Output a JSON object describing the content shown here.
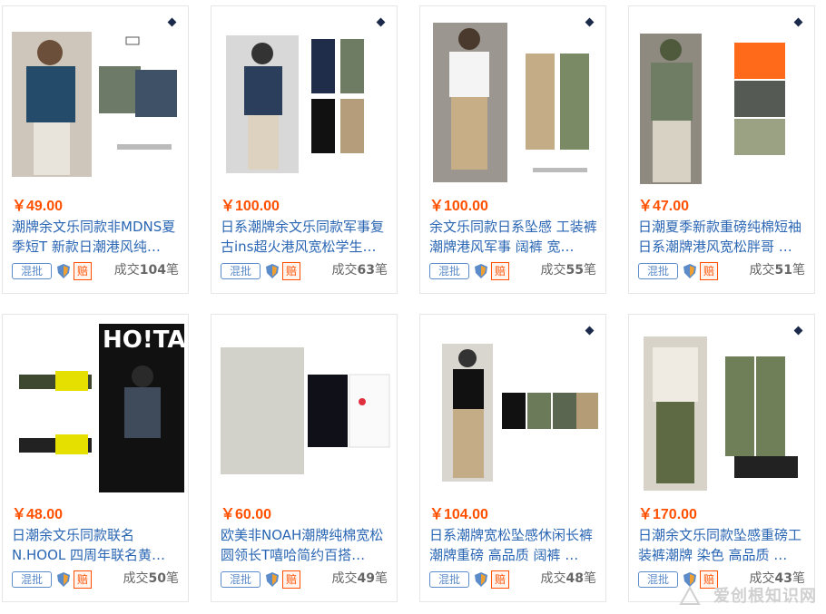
{
  "cards": [
    {
      "price": "￥49.00",
      "title": "潮牌余文乐同款非MDNS夏季短T 新款日潮港风纯…",
      "badge": "混批",
      "pei": "赔",
      "sold_prefix": "成交",
      "sold_num": "104",
      "sold_suffix": "笔"
    },
    {
      "price": "￥100.00",
      "title": "日系潮牌余文乐同款军事复古ins超火港风宽松学生…",
      "badge": "混批",
      "pei": "赔",
      "sold_prefix": "成交",
      "sold_num": "63",
      "sold_suffix": "笔"
    },
    {
      "price": "￥100.00",
      "title": "余文乐同款日系坠感 工装裤潮牌港风军事 阔裤 宽…",
      "badge": "混批",
      "pei": "赔",
      "sold_prefix": "成交",
      "sold_num": "55",
      "sold_suffix": "笔"
    },
    {
      "price": "￥47.00",
      "title": "日潮夏季新款重磅纯棉短袖日系潮牌港风宽松胖哥 …",
      "badge": "混批",
      "pei": "赔",
      "sold_prefix": "成交",
      "sold_num": "51",
      "sold_suffix": "笔"
    },
    {
      "price": "￥48.00",
      "title": "日潮余文乐同款联名N.HOOL 四周年联名黄…",
      "badge": "混批",
      "pei": "赔",
      "sold_prefix": "成交",
      "sold_num": "50",
      "sold_suffix": "笔"
    },
    {
      "price": "￥60.00",
      "title": "欧美非NOAH潮牌纯棉宽松圆领长T嘻哈简约百搭…",
      "badge": "混批",
      "pei": "赔",
      "sold_prefix": "成交",
      "sold_num": "49",
      "sold_suffix": "笔"
    },
    {
      "price": "￥104.00",
      "title": "日系潮牌宽松坠感休闲长裤潮牌重磅 高品质 阔裤 …",
      "badge": "混批",
      "pei": "赔",
      "sold_prefix": "成交",
      "sold_num": "48",
      "sold_suffix": "笔"
    },
    {
      "price": "￥170.00",
      "title": "日潮余文乐同款坠感重磅工装裤潮牌 染色 高品质 …",
      "badge": "混批",
      "pei": "赔",
      "sold_prefix": "成交",
      "sold_num": "43",
      "sold_suffix": "笔"
    }
  ],
  "watermark": "爱创根知识网",
  "colors": {
    "price": "#ff5000",
    "title": "#2a66b3",
    "badge_blue": "#5b8bc9"
  }
}
